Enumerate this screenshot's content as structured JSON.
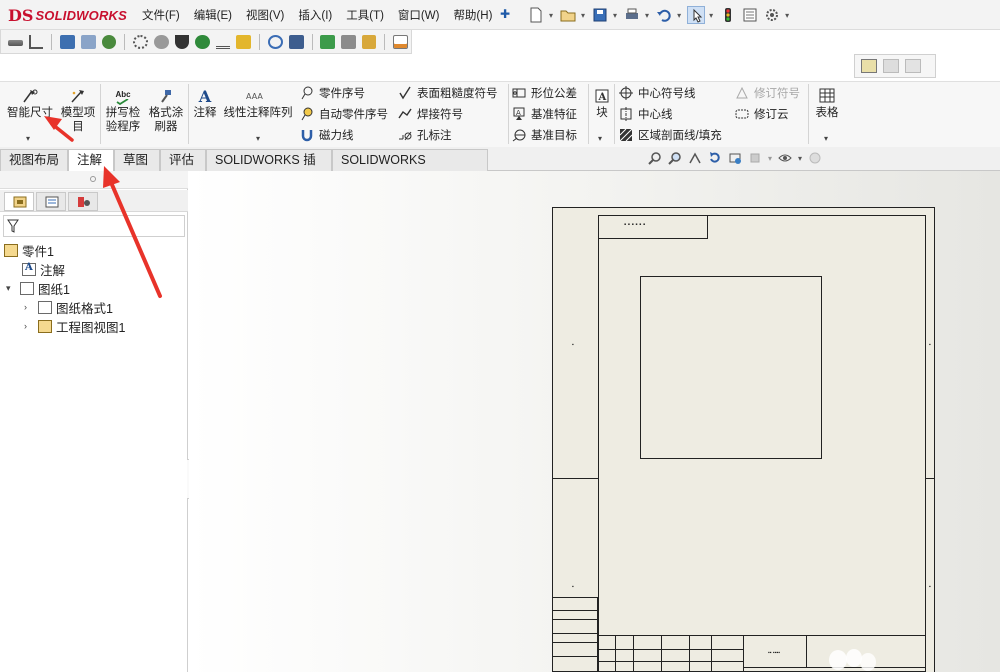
{
  "app": {
    "logo_ds": "DS",
    "logo_text": "SOLIDWORKS"
  },
  "menu": [
    "文件(F)",
    "编辑(E)",
    "视图(V)",
    "插入(I)",
    "工具(T)",
    "窗口(W)",
    "帮助(H)"
  ],
  "ribbon": {
    "smart_dim": "智能尺寸",
    "model_items_1": "模型项",
    "model_items_2": "目",
    "spell_1": "拼写检",
    "spell_2": "验程序",
    "spell_badge": "Abc",
    "format_1": "格式涂",
    "format_2": "刷器",
    "note": "注释",
    "linear_note": "线性注释阵列",
    "balloon": "零件序号",
    "auto_balloon": "自动零件序号",
    "magnetic_line": "磁力线",
    "surface_finish": "表面粗糙度符号",
    "weld_symbol": "焊接符号",
    "hole_callout": "孔标注",
    "gtol": "形位公差",
    "datum_feature": "基准特征",
    "datum_target": "基准目标",
    "block": "块",
    "center_mark": "中心符号线",
    "centerline": "中心线",
    "hatch": "区域剖面线/填充",
    "revision_symbol": "修订符号",
    "revision_cloud": "修订云",
    "table": "表格"
  },
  "tabs": [
    {
      "label": "视图布局",
      "active": false
    },
    {
      "label": "注解",
      "active": true
    },
    {
      "label": "草图",
      "active": false
    },
    {
      "label": "评估",
      "active": false
    },
    {
      "label": "SOLIDWORKS 插件",
      "active": false
    },
    {
      "label": "SOLIDWORKS Inspection",
      "active": false
    }
  ],
  "tree": {
    "root": "零件1",
    "annotations": "注解",
    "sheet": "图纸1",
    "sheet_format": "图纸格式1",
    "drawing_view": "工程图视图1"
  },
  "colors": {
    "brand_red": "#c8102e",
    "annotation_arrow": "#e8332a",
    "sheet_fill": "#eeece2"
  }
}
